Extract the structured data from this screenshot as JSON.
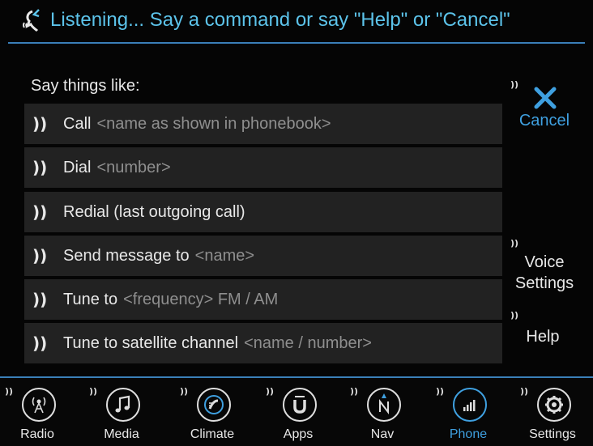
{
  "header": {
    "title": "Listening... Say a command or say \"Help\" or \"Cancel\""
  },
  "prompt": "Say things like:",
  "commands": [
    {
      "main": "Call",
      "hint": "<name as shown in phonebook>"
    },
    {
      "main": "Dial",
      "hint": "<number>"
    },
    {
      "main": "Redial (last outgoing call)",
      "hint": ""
    },
    {
      "main": "Send message to",
      "hint": "<name>"
    },
    {
      "main": "Tune to",
      "hint": "<frequency> FM / AM"
    },
    {
      "main": "Tune to satellite channel",
      "hint": "<name / number>"
    }
  ],
  "side": {
    "cancel": "Cancel",
    "voice_line1": "Voice",
    "voice_line2": "Settings",
    "help": "Help"
  },
  "tabs": [
    {
      "label": "Radio",
      "icon": "radio-icon"
    },
    {
      "label": "Media",
      "icon": "music-note-icon"
    },
    {
      "label": "Climate",
      "icon": "climate-icon"
    },
    {
      "label": "Apps",
      "icon": "apps-icon"
    },
    {
      "label": "Nav",
      "icon": "compass-icon"
    },
    {
      "label": "Phone",
      "icon": "signal-bars-icon",
      "active": true
    },
    {
      "label": "Settings",
      "icon": "gear-icon"
    }
  ],
  "speaker_glyph": "))",
  "colors": {
    "accent": "#3fa0e0",
    "header_text": "#5cc3ea",
    "row_bg": "#222222",
    "hint_text": "#8f8f8f"
  }
}
